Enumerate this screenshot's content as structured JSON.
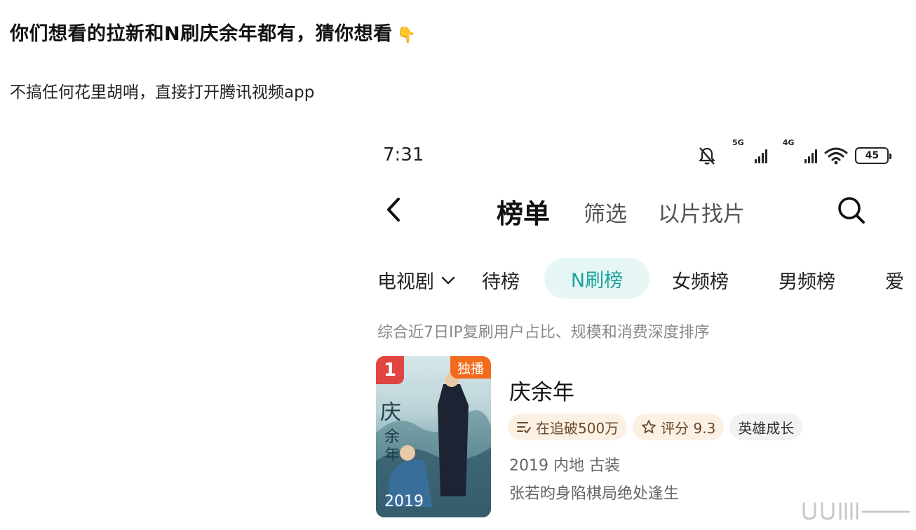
{
  "post": {
    "title": "你们想看的拉新和N刷庆余年都有，猜你想看",
    "title_emoji": "👇",
    "body": "不搞任何花里胡哨，直接打开腾讯视频app"
  },
  "status_bar": {
    "time": "7:31",
    "sim1_tag": "5G",
    "sim2_tag": "4G",
    "battery": "45",
    "icons": [
      "bell-muted-icon",
      "signal-5g-icon",
      "signal-4g-icon",
      "wifi-icon",
      "battery-icon"
    ]
  },
  "nav": {
    "main_title": "榜单",
    "tab_filter": "筛选",
    "tab_search_by_image": "以片找片",
    "icons": [
      "back-arrow-icon",
      "search-icon"
    ]
  },
  "category_row": {
    "dropdown_label": "电视剧",
    "pills": [
      "待榜",
      "N刷榜",
      "女频榜",
      "男频榜",
      "爱"
    ],
    "active_pill": "N刷榜"
  },
  "rank_description": "综合近7日IP复刷用户占比、规模和消费深度排序",
  "items": [
    {
      "rank": "1",
      "exclusive_badge": "独播",
      "poster_year": "2019",
      "title": "庆余年",
      "follow_tag": "在追破500万",
      "score_tag": "评分 9.3",
      "genre_tag": "英雄成长",
      "meta": "2019 内地 古装",
      "blurb": "张若昀身陷棋局绝处逢生"
    }
  ],
  "colors": {
    "accent": "#1aa39c",
    "accent_bg": "#e6f6f5",
    "rank_badge": "#e0453f",
    "exclusive_badge": "#f26b1d",
    "warm_tag_bg": "#fbf0e4"
  }
}
